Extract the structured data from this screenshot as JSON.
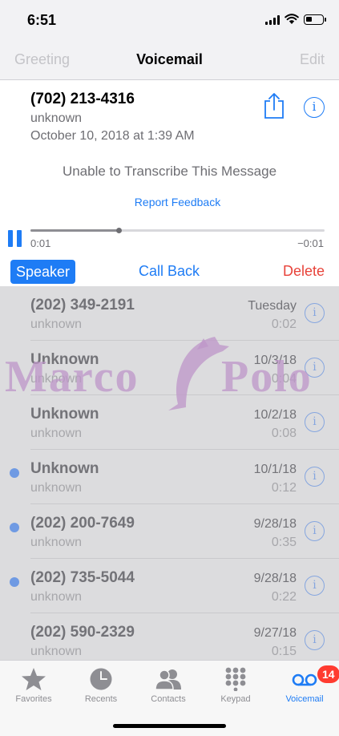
{
  "status_bar": {
    "time": "6:51"
  },
  "nav": {
    "left": "Greeting",
    "title": "Voicemail",
    "right": "Edit"
  },
  "detail": {
    "number": "(702) 213-4316",
    "label": "unknown",
    "date": "October 10, 2018 at 1:39 AM",
    "transcription": "Unable to Transcribe This Message",
    "feedback": "Report Feedback",
    "progress_fraction": 0.3,
    "elapsed": "0:01",
    "remaining": "−0:01",
    "speaker": "Speaker",
    "call_back": "Call Back",
    "delete": "Delete",
    "icons": {
      "share": "share-icon",
      "info": "info-icon",
      "pause": "pause-icon"
    }
  },
  "voicemails": [
    {
      "name": "(202) 349-2191",
      "label": "unknown",
      "date": "Tuesday",
      "duration": "0:02",
      "unread": false
    },
    {
      "name": "Unknown",
      "label": "unknown",
      "date": "10/3/18",
      "duration": "0:04",
      "unread": false
    },
    {
      "name": "Unknown",
      "label": "unknown",
      "date": "10/2/18",
      "duration": "0:08",
      "unread": false
    },
    {
      "name": "Unknown",
      "label": "unknown",
      "date": "10/1/18",
      "duration": "0:12",
      "unread": true
    },
    {
      "name": "(202) 200-7649",
      "label": "unknown",
      "date": "9/28/18",
      "duration": "0:35",
      "unread": true
    },
    {
      "name": "(202) 735-5044",
      "label": "unknown",
      "date": "9/28/18",
      "duration": "0:22",
      "unread": true
    },
    {
      "name": "(202) 590-2329",
      "label": "unknown",
      "date": "9/27/18",
      "duration": "0:15",
      "unread": false
    }
  ],
  "watermark": {
    "left": "Marco",
    "right": "Polo"
  },
  "tabs": [
    {
      "label": "Favorites",
      "icon": "star-icon",
      "active": false
    },
    {
      "label": "Recents",
      "icon": "clock-icon",
      "active": false
    },
    {
      "label": "Contacts",
      "icon": "contacts-icon",
      "active": false
    },
    {
      "label": "Keypad",
      "icon": "keypad-icon",
      "active": false
    },
    {
      "label": "Voicemail",
      "icon": "voicemail-icon",
      "active": true
    }
  ],
  "voicemail_badge": "14",
  "colors": {
    "accent": "#1e7cf5",
    "destructive": "#e8433a",
    "unread": "#6f9ae3",
    "badge": "#ff3b30"
  }
}
